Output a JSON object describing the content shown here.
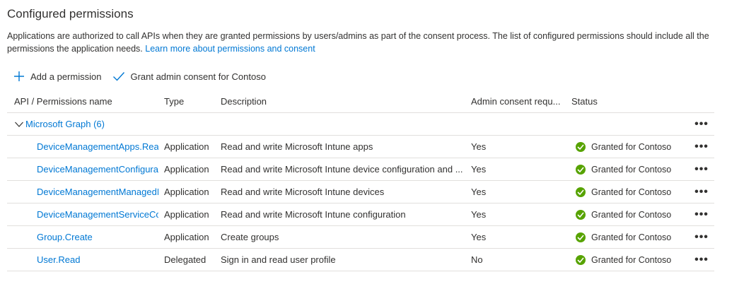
{
  "section": {
    "title": "Configured permissions",
    "description": "Applications are authorized to call APIs when they are granted permissions by users/admins as part of the consent process. The list of configured permissions should include all the permissions the application needs.",
    "learn_more": "Learn more about permissions and consent"
  },
  "toolbar": {
    "add_label": "Add a permission",
    "grant_label": "Grant admin consent for Contoso"
  },
  "table": {
    "headers": {
      "api": "API / Permissions name",
      "type": "Type",
      "description": "Description",
      "admin": "Admin consent requ...",
      "status": "Status"
    },
    "group": {
      "label": "Microsoft Graph (6)",
      "more": "•••"
    },
    "rows": [
      {
        "name": "DeviceManagementApps.ReadW",
        "type": "Application",
        "description": "Read and write Microsoft Intune apps",
        "admin": "Yes",
        "status": "Granted for Contoso",
        "more": "•••"
      },
      {
        "name": "DeviceManagementConfiguratic",
        "type": "Application",
        "description": "Read and write Microsoft Intune device configuration and ...",
        "admin": "Yes",
        "status": "Granted for Contoso",
        "more": "•••"
      },
      {
        "name": "DeviceManagementManagedDe",
        "type": "Application",
        "description": "Read and write Microsoft Intune devices",
        "admin": "Yes",
        "status": "Granted for Contoso",
        "more": "•••"
      },
      {
        "name": "DeviceManagementServiceConfi",
        "type": "Application",
        "description": "Read and write Microsoft Intune configuration",
        "admin": "Yes",
        "status": "Granted for Contoso",
        "more": "•••"
      },
      {
        "name": "Group.Create",
        "type": "Application",
        "description": "Create groups",
        "admin": "Yes",
        "status": "Granted for Contoso",
        "more": "•••"
      },
      {
        "name": "User.Read",
        "type": "Delegated",
        "description": "Sign in and read user profile",
        "admin": "No",
        "status": "Granted for Contoso",
        "more": "•••"
      }
    ]
  },
  "colors": {
    "link": "#0078d4",
    "success": "#57a300",
    "text": "#323130",
    "divider": "#e1dfdd"
  },
  "icons": {
    "add": "plus-icon",
    "grant": "checkmark-icon",
    "group": "chevron-down-icon",
    "status": "success-check-icon",
    "more": "more-ellipsis-icon"
  }
}
